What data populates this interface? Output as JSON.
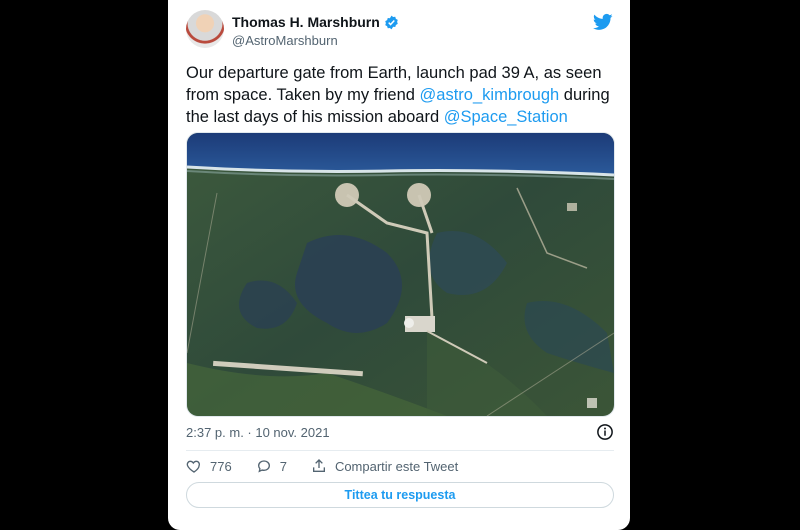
{
  "tweet": {
    "author_name": "Thomas H. Marshburn",
    "author_handle": "@AstroMarshburn",
    "text_parts": [
      {
        "type": "text",
        "value": "Our departure gate from Earth, launch pad 39 A, as seen from space. Taken by my friend "
      },
      {
        "type": "mention",
        "value": "@astro_kimbrough"
      },
      {
        "type": "text",
        "value": " during the last days of his mission aboard "
      },
      {
        "type": "mention",
        "value": "@Space_Station"
      }
    ],
    "timestamp": "2:37 p. m. · 10 nov. 2021",
    "likes": "776",
    "replies": "7",
    "share_label": "Compartir este Tweet",
    "reply_cta": "Tittea tu respuesta"
  },
  "icons": {
    "verified": "verified-badge-icon",
    "brand": "twitter-bird-icon",
    "info": "info-icon",
    "like": "heart-icon",
    "reply": "speech-bubble-icon",
    "share": "share-icon"
  },
  "colors": {
    "accent": "#1d9bf0",
    "text": "#0f1419",
    "muted": "#536471"
  }
}
